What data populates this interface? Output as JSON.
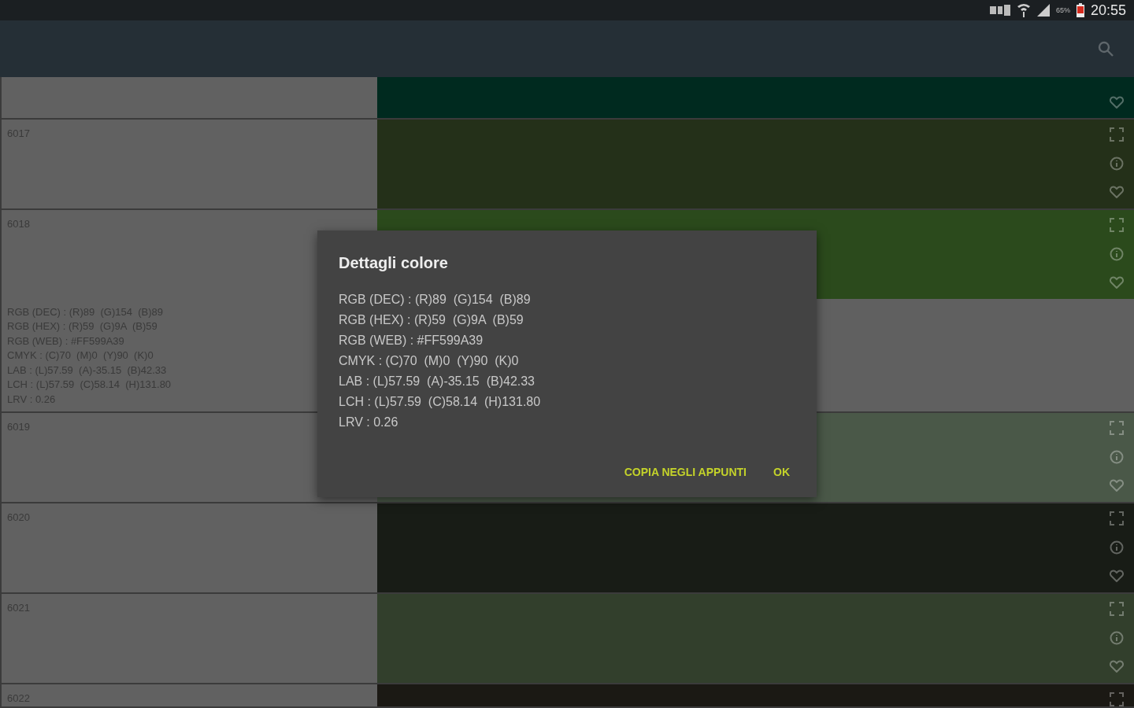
{
  "status_bar": {
    "battery_percent": "65%",
    "time": "20:55"
  },
  "rows": [
    {
      "kind": "cut-top",
      "color": "#002a1f"
    },
    {
      "kind": "full",
      "code": "6017",
      "color": "#243019",
      "expanded": false
    },
    {
      "kind": "full",
      "code": "6018",
      "color": "#2b4a1c",
      "expanded": true,
      "details": [
        "RGB (DEC) : (R)89  (G)154  (B)89",
        "RGB (HEX) : (R)59  (G)9A  (B)59",
        "RGB (WEB) : #FF599A39",
        "CMYK : (C)70  (M)0  (Y)90  (K)0",
        "LAB : (L)57.59  (A)-35.15  (B)42.33",
        "LCH : (L)57.59  (C)58.14  (H)131.80",
        "LRV : 0.26"
      ]
    },
    {
      "kind": "full",
      "code": "6019",
      "color": "#4a5848",
      "expanded": false
    },
    {
      "kind": "full",
      "code": "6020",
      "color": "#181c16",
      "expanded": false
    },
    {
      "kind": "full",
      "code": "6021",
      "color": "#323f2c",
      "expanded": false
    },
    {
      "kind": "cut-bottom",
      "code": "6022",
      "color": "#1b1914"
    }
  ],
  "dialog": {
    "title": "Dettagli colore",
    "lines": [
      "RGB (DEC) : (R)89  (G)154  (B)89",
      "RGB (HEX) : (R)59  (G)9A  (B)59",
      "RGB (WEB) : #FF599A39",
      "CMYK : (C)70  (M)0  (Y)90  (K)0",
      "LAB : (L)57.59  (A)-35.15  (B)42.33",
      "LCH : (L)57.59  (C)58.14  (H)131.80",
      "LRV : 0.26"
    ],
    "buttons": [
      "COPIA NEGLI APPUNTI",
      "OK"
    ]
  }
}
